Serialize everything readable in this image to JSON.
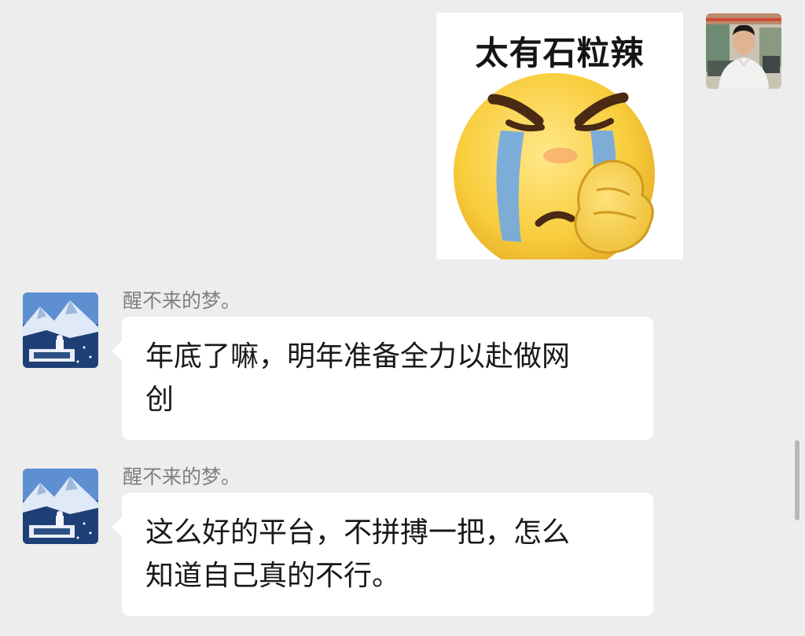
{
  "sticker": {
    "caption": "太有石粒辣",
    "icon": "crying-face-icon"
  },
  "messages": [
    {
      "sender": "醒不来的梦。",
      "lines": [
        "年底了嘛，明年准备全力以赴做网",
        "创"
      ]
    },
    {
      "sender": "醒不来的梦。",
      "lines": [
        "这么好的平台，不拼搏一把，怎么",
        "知道自己真的不行。"
      ]
    }
  ],
  "colors": {
    "background": "#ededed",
    "bubble": "#ffffff",
    "sender_name": "#7f7f7f",
    "text": "#191919"
  }
}
